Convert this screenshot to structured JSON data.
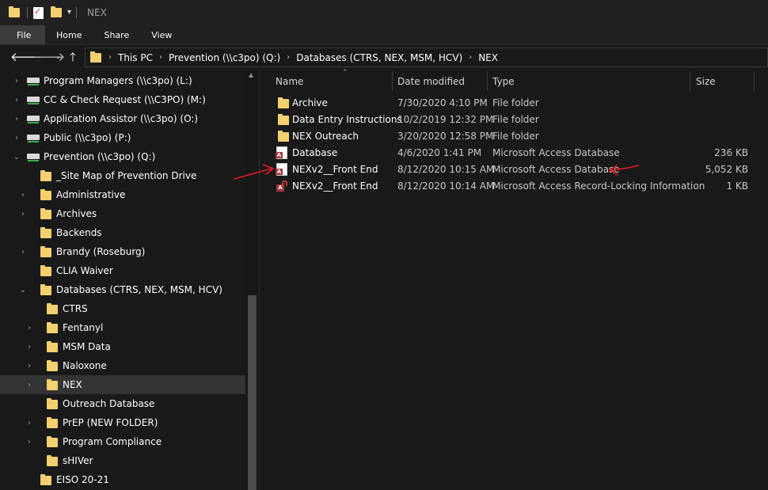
{
  "titlebar": {
    "title": "NEX",
    "separator": "|"
  },
  "ribbon": {
    "tabs": [
      "File",
      "Home",
      "Share",
      "View"
    ]
  },
  "address": {
    "crumbs": [
      "This PC",
      "Prevention (\\\\c3po) (Q:)",
      "Databases (CTRS, NEX, MSM, HCV)",
      "NEX"
    ]
  },
  "nav": {
    "items": [
      {
        "label": "Program Managers (\\\\c3po) (L:)",
        "icon": "network-drive-icon",
        "chevron": "right"
      },
      {
        "label": "CC & Check Request (\\\\C3PO) (M:)",
        "icon": "network-drive-icon",
        "chevron": "right"
      },
      {
        "label": "Application Assistor (\\\\c3po) (O:)",
        "icon": "network-drive-icon",
        "chevron": "right"
      },
      {
        "label": "Public (\\\\c3po) (P:)",
        "icon": "network-drive-icon",
        "chevron": "right"
      },
      {
        "label": "Prevention (\\\\c3po) (Q:)",
        "icon": "network-drive-icon",
        "chevron": "down"
      },
      {
        "label": "_Site Map of Prevention Drive",
        "icon": "folder-icon",
        "chevron": "none"
      },
      {
        "label": "Administrative",
        "icon": "folder-icon",
        "chevron": "right"
      },
      {
        "label": "Archives",
        "icon": "folder-icon",
        "chevron": "right"
      },
      {
        "label": "Backends",
        "icon": "folder-icon",
        "chevron": "none"
      },
      {
        "label": "Brandy (Roseburg)",
        "icon": "folder-icon",
        "chevron": "right"
      },
      {
        "label": "CLIA Waiver",
        "icon": "folder-icon",
        "chevron": "none"
      },
      {
        "label": "Databases (CTRS, NEX, MSM, HCV)",
        "icon": "folder-icon",
        "chevron": "down"
      },
      {
        "label": "CTRS",
        "icon": "folder-icon",
        "chevron": "none"
      },
      {
        "label": "Fentanyl",
        "icon": "folder-icon",
        "chevron": "right"
      },
      {
        "label": "MSM Data",
        "icon": "folder-icon",
        "chevron": "right"
      },
      {
        "label": "Naloxone",
        "icon": "folder-icon",
        "chevron": "right"
      },
      {
        "label": "NEX",
        "icon": "folder-icon",
        "chevron": "right",
        "selected": true
      },
      {
        "label": "Outreach Database",
        "icon": "folder-icon",
        "chevron": "none"
      },
      {
        "label": "PrEP (NEW FOLDER)",
        "icon": "folder-icon",
        "chevron": "right"
      },
      {
        "label": "Program Compliance",
        "icon": "folder-icon",
        "chevron": "right"
      },
      {
        "label": "sHIVer",
        "icon": "folder-icon",
        "chevron": "none"
      },
      {
        "label": "EISO 20-21",
        "icon": "folder-icon",
        "chevron": "none"
      }
    ]
  },
  "files": {
    "headers": {
      "name": "Name",
      "date": "Date modified",
      "type": "Type",
      "size": "Size"
    },
    "rows": [
      {
        "name": "Archive",
        "date": "7/30/2020 4:10 PM",
        "type": "File folder",
        "size": "",
        "icon": "folder-icon"
      },
      {
        "name": "Data Entry Instructions",
        "date": "10/2/2019 12:32 PM",
        "type": "File folder",
        "size": "",
        "icon": "folder-icon"
      },
      {
        "name": "NEX Outreach",
        "date": "3/20/2020 12:58 PM",
        "type": "File folder",
        "size": "",
        "icon": "folder-icon"
      },
      {
        "name": "Database",
        "date": "4/6/2020 1:41 PM",
        "type": "Microsoft Access Database",
        "size": "236 KB",
        "icon": "access-database-icon"
      },
      {
        "name": "NEXv2__Front End",
        "date": "8/12/2020 10:15 AM",
        "type": "Microsoft Access Database",
        "size": "5,052 KB",
        "icon": "access-database-icon"
      },
      {
        "name": "NEXv2__Front End",
        "date": "8/12/2020 10:14 AM",
        "type": "Microsoft Access Record-Locking Information",
        "size": "1 KB",
        "icon": "access-lock-file-icon"
      }
    ]
  },
  "colors": {
    "background": "#191919",
    "folder": "#f4d06f",
    "selection": "#333333",
    "annotation": "#e8162b",
    "access": "#a4373a"
  }
}
